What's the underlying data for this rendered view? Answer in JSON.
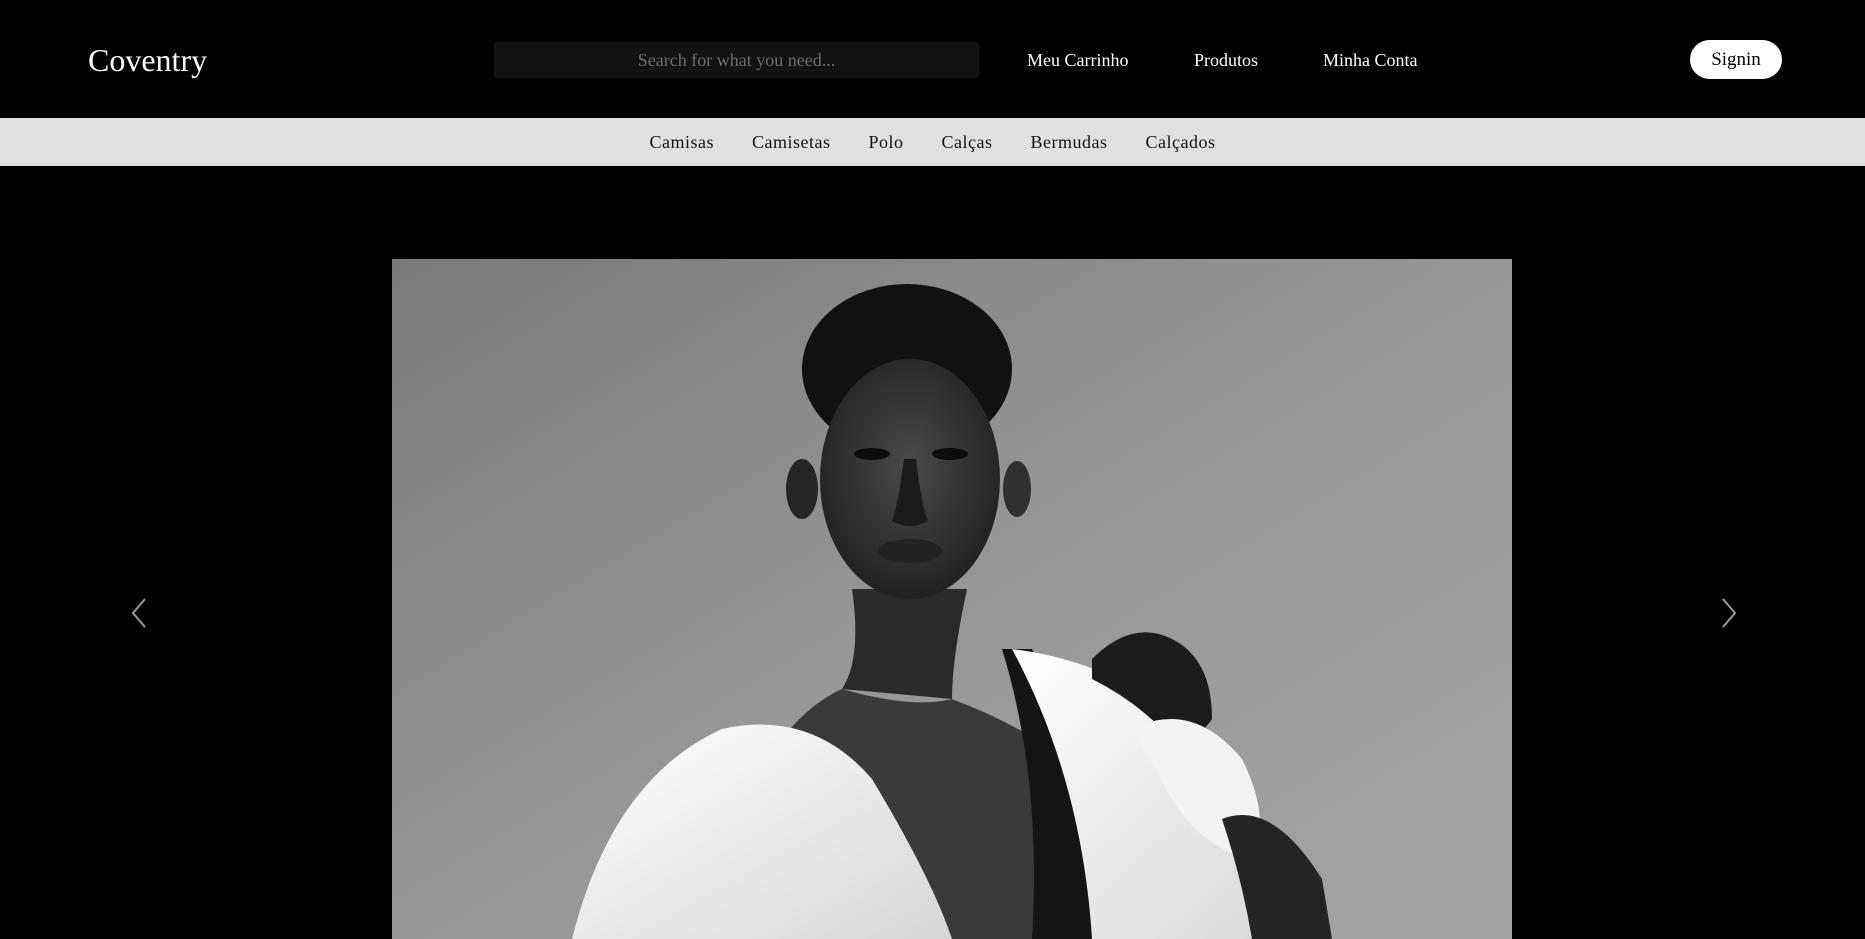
{
  "header": {
    "logo": "Coventry",
    "search_placeholder": "Search for what you need...",
    "nav": {
      "cart": "Meu Carrinho",
      "products": "Produtos",
      "account": "Minha Conta"
    },
    "signin_label": "Signin"
  },
  "categories": [
    "Camisas",
    "Camisetas",
    "Polo",
    "Calças",
    "Bermudas",
    "Calçados"
  ],
  "carousel": {
    "prev_icon": "chevron-left-icon",
    "next_icon": "chevron-right-icon"
  },
  "colors": {
    "background": "#000000",
    "category_bar": "#e0e0e0",
    "search_bg": "#121212",
    "signin_bg": "#ffffff"
  }
}
